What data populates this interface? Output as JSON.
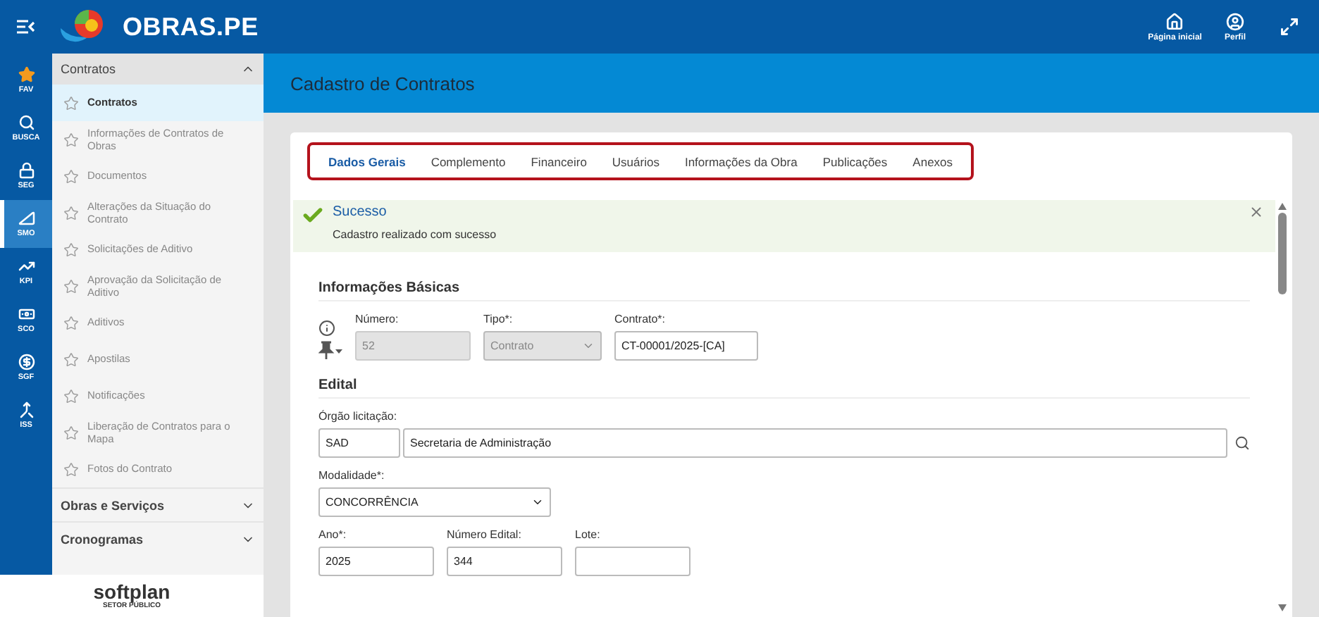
{
  "header": {
    "logo_text": "OBRAS.PE",
    "actions": [
      {
        "kind": "home",
        "label": "Página inicial"
      },
      {
        "kind": "profile",
        "label": "Perfil"
      }
    ]
  },
  "rail": [
    {
      "kind": "star",
      "label": "FAV",
      "selected": false
    },
    {
      "kind": "search",
      "label": "BUSCA",
      "selected": false
    },
    {
      "kind": "lock",
      "label": "SEG",
      "selected": false
    },
    {
      "kind": "ruler",
      "label": "SMO",
      "selected": true
    },
    {
      "kind": "chart",
      "label": "KPI",
      "selected": false
    },
    {
      "kind": "money",
      "label": "SCO",
      "selected": false
    },
    {
      "kind": "dollar",
      "label": "SGF",
      "selected": false
    },
    {
      "kind": "split",
      "label": "ISS",
      "selected": false
    }
  ],
  "sidebar": {
    "groups": [
      {
        "title": "Contratos",
        "expanded": true,
        "items": [
          {
            "label": "Contratos",
            "selected": true
          },
          {
            "label": "Informações de Contratos de Obras",
            "selected": false
          },
          {
            "label": "Documentos",
            "selected": false
          },
          {
            "label": "Alterações da Situação do Contrato",
            "selected": false
          },
          {
            "label": "Solicitações de Aditivo",
            "selected": false
          },
          {
            "label": "Aprovação da Solicitação de Aditivo",
            "selected": false
          },
          {
            "label": "Aditivos",
            "selected": false
          },
          {
            "label": "Apostilas",
            "selected": false
          },
          {
            "label": "Notificações",
            "selected": false
          },
          {
            "label": "Liberação de Contratos para o Mapa",
            "selected": false
          },
          {
            "label": "Fotos do Contrato",
            "selected": false
          }
        ]
      },
      {
        "title": "Obras e Serviços",
        "expanded": false
      },
      {
        "title": "Cronogramas",
        "expanded": false
      }
    ]
  },
  "footer": {
    "brand": "softplan",
    "tagline": "SETOR PÚBLICO"
  },
  "page_title": "Cadastro de Contratos",
  "tabs": [
    {
      "label": "Dados Gerais",
      "selected": true
    },
    {
      "label": "Complemento",
      "selected": false
    },
    {
      "label": "Financeiro",
      "selected": false
    },
    {
      "label": "Usuários",
      "selected": false
    },
    {
      "label": "Informações da Obra",
      "selected": false
    },
    {
      "label": "Publicações",
      "selected": false
    },
    {
      "label": "Anexos",
      "selected": false
    }
  ],
  "alert": {
    "title": "Sucesso",
    "message": "Cadastro realizado com sucesso"
  },
  "sections": [
    {
      "title": "Informações Básicas",
      "pinned_tools": true,
      "rows": [
        [
          {
            "kind": "text",
            "label": "Número:",
            "value": "52",
            "disabled": true
          },
          {
            "kind": "select",
            "label": "Tipo*:",
            "value": "Contrato",
            "disabled": true
          },
          {
            "kind": "text",
            "label": "Contrato*:",
            "value": "CT-00001/2025-[CA]",
            "disabled": false
          }
        ]
      ]
    },
    {
      "title": "Edital",
      "pinned_tools": false,
      "rows": [
        [
          {
            "kind": "lookup",
            "label": "Órgão licitação:",
            "code": "SAD",
            "value": "Secretaria de Administração",
            "disabled": false
          }
        ],
        [
          {
            "kind": "select",
            "label": "Modalidade*:",
            "value": "CONCORRÊNCIA",
            "disabled": false
          }
        ],
        [
          {
            "kind": "text",
            "label": "Ano*:",
            "value": "2025",
            "disabled": false
          },
          {
            "kind": "text",
            "label": "Número Edital:",
            "value": "344",
            "disabled": false
          },
          {
            "kind": "text",
            "label": "Lote:",
            "disabled": false
          }
        ]
      ]
    }
  ]
}
